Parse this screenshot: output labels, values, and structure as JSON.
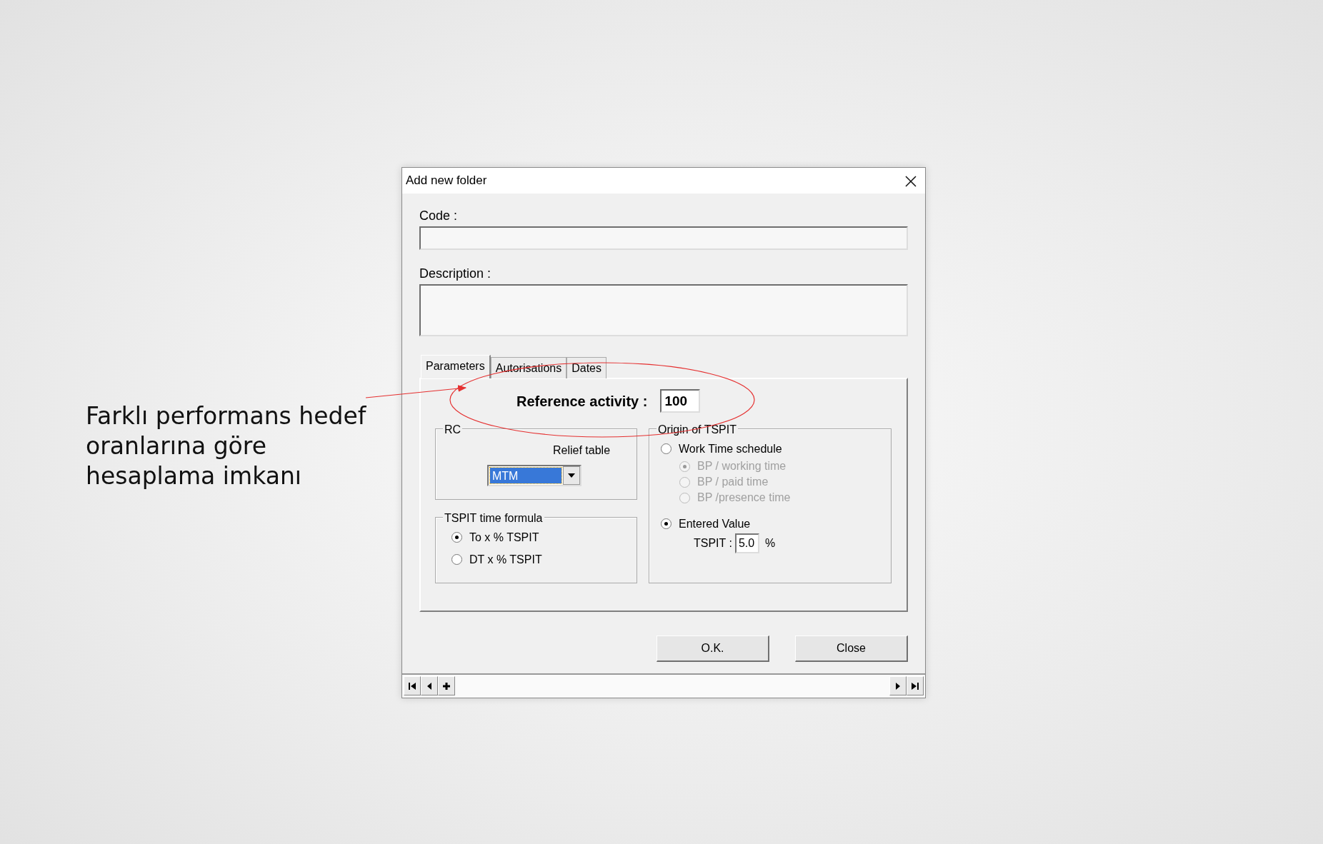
{
  "annotation": {
    "text": "Farklı performans hedef oranlarına göre hesaplama imkanı"
  },
  "window": {
    "title": "Add new folder"
  },
  "fields": [
    {
      "label": "Code :",
      "kind": "line"
    },
    {
      "label": "Description :",
      "kind": "area"
    }
  ],
  "tabs": [
    {
      "label": "Parameters",
      "selected": true
    },
    {
      "label": "Autorisations",
      "selected": false
    },
    {
      "label": "Dates",
      "selected": false
    }
  ],
  "reference_activity": {
    "label": "Reference activity :",
    "value": "100"
  },
  "rc": {
    "title": "RC",
    "relief_label": "Relief table",
    "relief_value": "MTM"
  },
  "tspit_formula": {
    "title": "TSPIT time formula",
    "options": [
      {
        "label": "To x % TSPIT",
        "selected": true
      },
      {
        "label": "DT x % TSPIT",
        "selected": false
      }
    ]
  },
  "origin": {
    "title": "Origin of TSPIT",
    "options": [
      {
        "label": "Work Time schedule",
        "selected": false,
        "disabled": false,
        "children": [
          {
            "label": "BP / working time",
            "selected": true,
            "disabled": true
          },
          {
            "label": "BP / paid time",
            "selected": false,
            "disabled": true
          },
          {
            "label": "BP /presence time",
            "selected": false,
            "disabled": true
          }
        ]
      },
      {
        "label": "Entered Value",
        "selected": true,
        "disabled": false
      }
    ],
    "tspit": {
      "label": "TSPIT :",
      "value": "5.0",
      "unit": "%"
    }
  },
  "buttons": [
    "O.K.",
    "Close"
  ]
}
